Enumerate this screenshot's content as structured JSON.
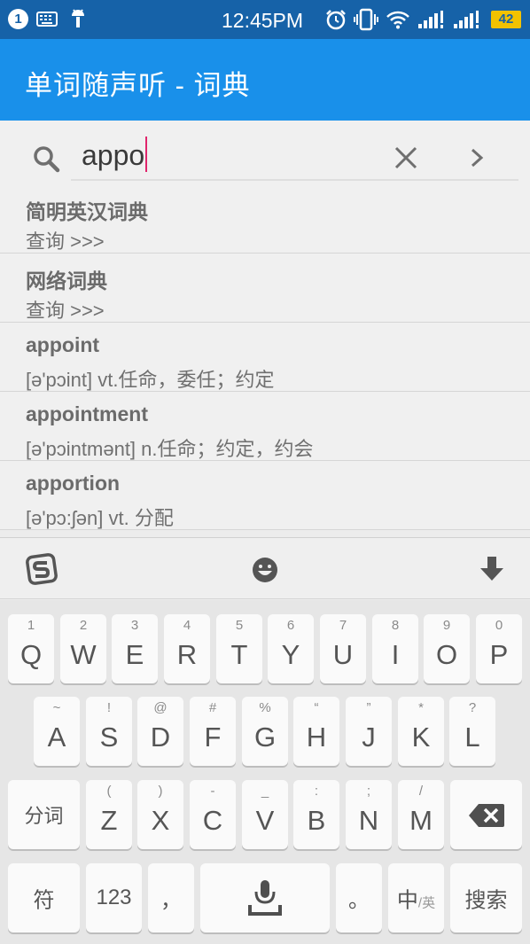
{
  "status_bar": {
    "notification_count": "1",
    "time": "12:45PM",
    "battery": "42"
  },
  "app_bar": {
    "title": "单词随声听 - 词典"
  },
  "search": {
    "query": "appo"
  },
  "results": [
    {
      "title": "简明英汉词典",
      "detail": "查询 >>>"
    },
    {
      "title": "网络词典",
      "detail": "查询 >>>"
    },
    {
      "title": "appoint",
      "detail": "[ə'pɔint] vt.任命，委任；约定"
    },
    {
      "title": "appointment",
      "detail": "[ə'pɔintmənt] n.任命；约定，约会"
    },
    {
      "title": "apportion",
      "detail": "[ə'pɔ:ʃən] vt. 分配"
    }
  ],
  "keyboard": {
    "row1": [
      {
        "main": "Q",
        "sub": "1"
      },
      {
        "main": "W",
        "sub": "2"
      },
      {
        "main": "E",
        "sub": "3"
      },
      {
        "main": "R",
        "sub": "4"
      },
      {
        "main": "T",
        "sub": "5"
      },
      {
        "main": "Y",
        "sub": "6"
      },
      {
        "main": "U",
        "sub": "7"
      },
      {
        "main": "I",
        "sub": "8"
      },
      {
        "main": "O",
        "sub": "9"
      },
      {
        "main": "P",
        "sub": "0"
      }
    ],
    "row2": [
      {
        "main": "A",
        "sub": "~"
      },
      {
        "main": "S",
        "sub": "!"
      },
      {
        "main": "D",
        "sub": "@"
      },
      {
        "main": "F",
        "sub": "#"
      },
      {
        "main": "G",
        "sub": "%"
      },
      {
        "main": "H",
        "sub": "“"
      },
      {
        "main": "J",
        "sub": "”"
      },
      {
        "main": "K",
        "sub": "*"
      },
      {
        "main": "L",
        "sub": "?"
      }
    ],
    "row3": [
      {
        "main": "Z",
        "sub": "("
      },
      {
        "main": "X",
        "sub": ")"
      },
      {
        "main": "C",
        "sub": "-"
      },
      {
        "main": "V",
        "sub": "_"
      },
      {
        "main": "B",
        "sub": ":"
      },
      {
        "main": "N",
        "sub": ";"
      },
      {
        "main": "M",
        "sub": "/"
      }
    ],
    "segment_label": "分词",
    "symbol_label": "符",
    "numeric_label": "123",
    "comma_label": "，",
    "period_label": "。",
    "lang_label_main": "中",
    "lang_label_sub": "/英",
    "search_label": "搜索"
  }
}
